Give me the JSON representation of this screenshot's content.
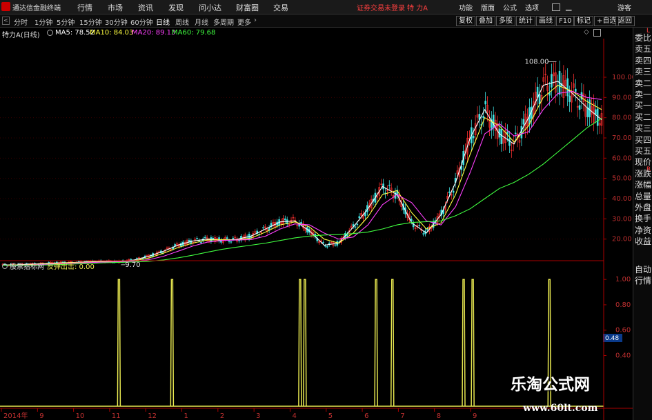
{
  "menubar": {
    "app_name": "通达信金融终端",
    "items": [
      "行情",
      "市场",
      "资讯",
      "发现",
      "问小达",
      "财富圈",
      "交易"
    ],
    "login_status": "证券交易未登录",
    "stock_name": "特 力A",
    "right_items": [
      "功能",
      "版面",
      "公式",
      "选项"
    ],
    "guest": "游客"
  },
  "toolbar": {
    "periods": [
      "分时",
      "1分钟",
      "5分钟",
      "15分钟",
      "30分钟",
      "60分钟",
      "日线",
      "周线",
      "月线",
      "多周期",
      "更多"
    ],
    "active_period": "日线",
    "buttons": [
      "复权",
      "叠加",
      "多股",
      "统计",
      "画线",
      "F10",
      "标记",
      "+自选",
      "返回"
    ]
  },
  "info": {
    "title": "特力A(日线)",
    "ma": [
      {
        "label": "MA5: 78.52",
        "color": "#ffffff"
      },
      {
        "label": "MA10: 84.03",
        "color": "#ffff40"
      },
      {
        "label": "MA20: 89.13",
        "color": "#ff40ff"
      },
      {
        "label": "MA60: 79.68",
        "color": "#40ff40"
      }
    ]
  },
  "indicator": {
    "name": "股票指标网",
    "formula": "反弹出击: 0.00",
    "current_label": "0.48"
  },
  "side_panel": [
    "委比",
    "卖五",
    "卖四",
    "卖三",
    "卖二",
    "卖一",
    "买一",
    "买二",
    "买三",
    "买四",
    "买五",
    "现价",
    "涨跌",
    "涨幅",
    "总量",
    "外盘",
    "换手",
    "净资",
    "收益"
  ],
  "side_panel_bottom": [
    "自动",
    "行情"
  ],
  "corner_labels": {
    "top": "L",
    "mid": "R"
  },
  "watermark": {
    "title": "乐淘公式网",
    "url": "www.60lt.com"
  },
  "chart_data": [
    {
      "type": "line",
      "title": "特力A(日线)",
      "y_ticks": [
        20.0,
        30.0,
        40.0,
        50.0,
        60.0,
        70.0,
        80.0,
        90.0,
        100.0
      ],
      "ylim": [
        10,
        115
      ],
      "annotations": [
        {
          "label": "108.00",
          "value": 108.0
        },
        {
          "label": "9.70",
          "value": 9.7
        }
      ],
      "x_labels": [
        "2014年",
        "9",
        "10",
        "11",
        "12",
        "1",
        "2",
        "3",
        "4",
        "5",
        "6",
        "7",
        "8",
        "9"
      ],
      "series": [
        {
          "name": "MA5",
          "color": "#ffffff",
          "values": [
            7.2,
            7.3,
            7.6,
            8.0,
            8.3,
            8.5,
            8.8,
            9.0,
            8.8,
            9.7,
            11.5,
            14,
            17,
            19,
            20,
            19.5,
            19.8,
            21.5,
            25,
            28.5,
            29,
            24,
            17,
            18,
            26,
            35,
            46,
            42,
            28,
            23,
            32,
            48,
            70,
            84,
            72,
            67,
            80,
            96,
            98,
            92,
            85,
            79
          ]
        },
        {
          "name": "MA10",
          "color": "#ffff40",
          "values": [
            7.1,
            7.2,
            7.4,
            7.8,
            8.2,
            8.4,
            8.6,
            8.8,
            8.9,
            9.3,
            10.6,
            13,
            15.8,
            18,
            19.5,
            19.7,
            19.5,
            20.5,
            23.5,
            27,
            28.5,
            26,
            20,
            18,
            23,
            31,
            42,
            44,
            33,
            25,
            28,
            42,
            62,
            80,
            76,
            68,
            76,
            90,
            96,
            93,
            88,
            84
          ]
        },
        {
          "name": "MA20",
          "color": "#ff40ff",
          "values": [
            7.0,
            7.1,
            7.2,
            7.5,
            7.9,
            8.2,
            8.4,
            8.6,
            8.8,
            9.0,
            9.8,
            11.5,
            14,
            16.5,
            18.5,
            19.3,
            19.5,
            19.8,
            21.5,
            25,
            27.5,
            27,
            23,
            20,
            21,
            27,
            37,
            42,
            38,
            29,
            27,
            36,
            53,
            72,
            77,
            71,
            73,
            84,
            92,
            93,
            90,
            89
          ]
        },
        {
          "name": "MA60",
          "color": "#40ff40",
          "values": [
            7.0,
            7.0,
            7.1,
            7.2,
            7.4,
            7.7,
            8.0,
            8.3,
            8.5,
            8.7,
            9.0,
            9.7,
            10.7,
            12,
            13.5,
            14.9,
            16,
            17,
            18,
            19.3,
            20.6,
            21.5,
            22,
            22.3,
            22.7,
            23.5,
            25,
            27,
            28.2,
            28.6,
            29,
            31.5,
            35,
            40,
            45,
            48,
            52,
            57,
            63,
            69,
            75,
            79.7
          ]
        }
      ]
    },
    {
      "type": "line",
      "title": "反弹出击",
      "y_ticks": [
        0.4,
        0.6,
        0.8,
        1.0
      ],
      "ylim": [
        0,
        1.05
      ],
      "series": [
        {
          "name": "反弹出击",
          "color": "#e8e850",
          "signal_x": [
            0.197,
            0.285,
            0.497,
            0.505,
            0.623,
            0.65,
            0.768,
            0.783,
            0.91
          ],
          "values": [
            1,
            1,
            1,
            1,
            1,
            1,
            1,
            1,
            1
          ]
        }
      ]
    }
  ]
}
